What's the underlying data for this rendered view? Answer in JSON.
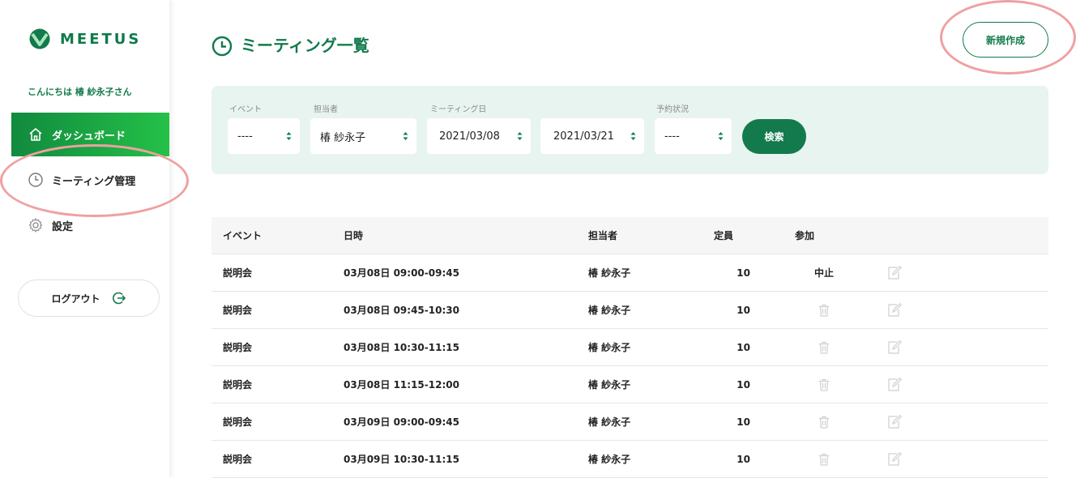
{
  "app": {
    "logo_text": "MEETUS"
  },
  "sidebar": {
    "greeting": "こんにちは 椿 紗永子さん",
    "items": [
      {
        "label": "ダッシュボード",
        "icon": "home-icon",
        "active": true
      },
      {
        "label": "ミーティング管理",
        "icon": "clock-icon",
        "active": false
      },
      {
        "label": "設定",
        "icon": "gear-icon",
        "active": false
      }
    ],
    "logout_label": "ログアウト"
  },
  "header": {
    "title": "ミーティング一覧",
    "new_button": "新規作成"
  },
  "filters": {
    "event": {
      "label": "イベント",
      "value": "----"
    },
    "staff": {
      "label": "担当者",
      "value": "椿 紗永子"
    },
    "date": {
      "label": "ミーティング日",
      "from": "2021/03/08",
      "to": "2021/03/21"
    },
    "status": {
      "label": "予約状況",
      "value": "----"
    },
    "search_button": "検索"
  },
  "table": {
    "headers": {
      "event": "イベント",
      "datetime": "日時",
      "staff": "担当者",
      "capacity": "定員",
      "participation": "参加"
    },
    "rows": [
      {
        "event": "説明会",
        "datetime": "03月08日 09:00-09:45",
        "staff": "椿 紗永子",
        "capacity": "10",
        "participation": "中止"
      },
      {
        "event": "説明会",
        "datetime": "03月08日 09:45-10:30",
        "staff": "椿 紗永子",
        "capacity": "10",
        "participation": ""
      },
      {
        "event": "説明会",
        "datetime": "03月08日 10:30-11:15",
        "staff": "椿 紗永子",
        "capacity": "10",
        "participation": ""
      },
      {
        "event": "説明会",
        "datetime": "03月08日 11:15-12:00",
        "staff": "椿 紗永子",
        "capacity": "10",
        "participation": ""
      },
      {
        "event": "説明会",
        "datetime": "03月09日 09:00-09:45",
        "staff": "椿 紗永子",
        "capacity": "10",
        "participation": ""
      },
      {
        "event": "説明会",
        "datetime": "03月09日 10:30-11:15",
        "staff": "椿 紗永子",
        "capacity": "10",
        "participation": ""
      }
    ]
  },
  "colors": {
    "brand": "#127a4c",
    "active_gradient_start": "#118a3e",
    "active_gradient_end": "#24c148",
    "filter_bg": "#e8f4ef",
    "highlight": "#f0a0a2"
  }
}
